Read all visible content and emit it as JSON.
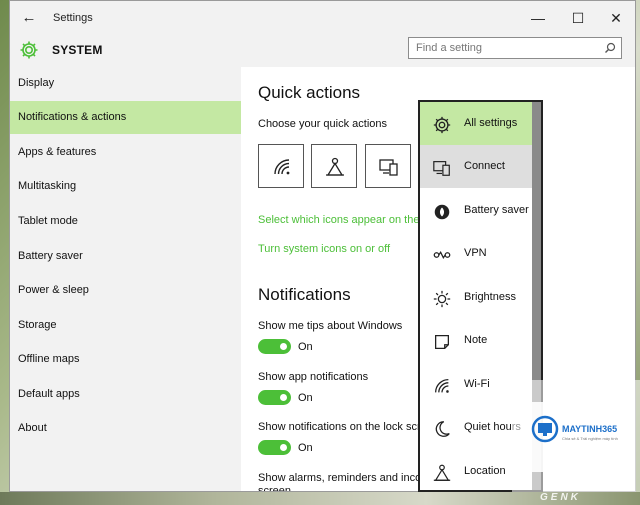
{
  "window": {
    "title": "Settings",
    "back_glyph": "←",
    "minimize_glyph": "—",
    "maximize_glyph": "☐",
    "close_glyph": "✕"
  },
  "header": {
    "section_title": "SYSTEM",
    "section_icon": "gear-icon",
    "accent_color": "#4cbf38"
  },
  "search": {
    "placeholder": "Find a setting",
    "icon": "search-icon"
  },
  "sidebar": {
    "items": [
      {
        "label": "Display",
        "active": false
      },
      {
        "label": "Notifications & actions",
        "active": true
      },
      {
        "label": "Apps & features",
        "active": false
      },
      {
        "label": "Multitasking",
        "active": false
      },
      {
        "label": "Tablet mode",
        "active": false
      },
      {
        "label": "Battery saver",
        "active": false
      },
      {
        "label": "Power & sleep",
        "active": false
      },
      {
        "label": "Storage",
        "active": false
      },
      {
        "label": "Offline maps",
        "active": false
      },
      {
        "label": "Default apps",
        "active": false
      },
      {
        "label": "About",
        "active": false
      }
    ]
  },
  "main": {
    "quick_actions_title": "Quick actions",
    "choose_label": "Choose your quick actions",
    "tiles": [
      "wifi-icon",
      "location-icon",
      "connect-icon"
    ],
    "link_select_icons": "Select which icons appear on the",
    "link_system_icons": "Turn system icons on or off",
    "notifications_title": "Notifications",
    "settings": [
      {
        "label": "Show me tips about Windows",
        "state": "On"
      },
      {
        "label": "Show app notifications",
        "state": "On"
      },
      {
        "label": "Show notifications on the lock scr",
        "state": "On"
      }
    ],
    "alarms_label": "Show alarms, reminders and incom",
    "alarms_label_2": "screen"
  },
  "flyout": {
    "items": [
      {
        "label": "All settings",
        "icon": "gear-icon",
        "state": "selected"
      },
      {
        "label": "Connect",
        "icon": "connect-icon",
        "state": "hover"
      },
      {
        "label": "Battery saver",
        "icon": "battery-saver-icon",
        "state": ""
      },
      {
        "label": "VPN",
        "icon": "vpn-icon",
        "state": ""
      },
      {
        "label": "Brightness",
        "icon": "brightness-icon",
        "state": ""
      },
      {
        "label": "Note",
        "icon": "note-icon",
        "state": ""
      },
      {
        "label": "Wi-Fi",
        "icon": "wifi-icon",
        "state": ""
      },
      {
        "label": "Quiet hours",
        "icon": "moon-icon",
        "state": ""
      },
      {
        "label": "Location",
        "icon": "location-icon",
        "state": ""
      }
    ]
  },
  "watermark": {
    "brand": "MAYTINH365",
    "tagline": "Chia sẻ & Trải nghiệm máy tính",
    "corner": "GENK"
  }
}
